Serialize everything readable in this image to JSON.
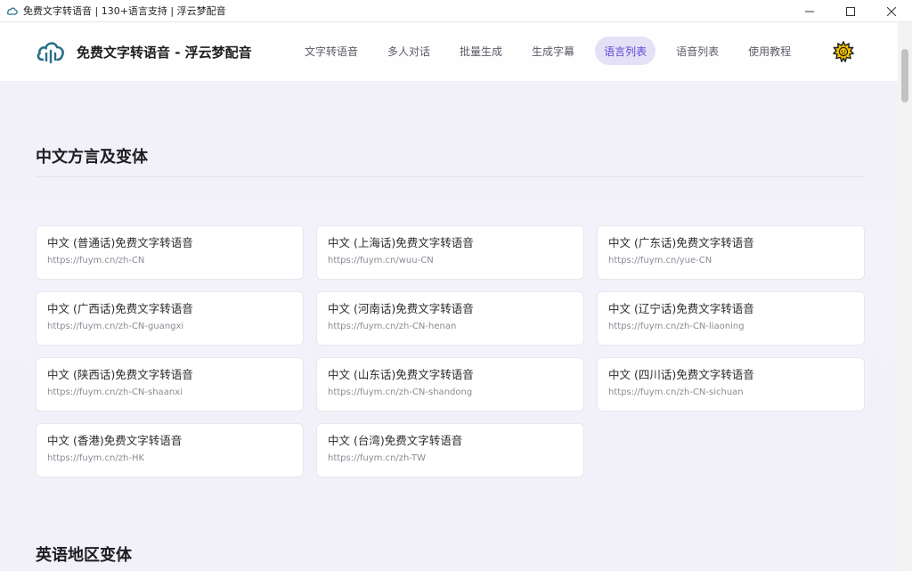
{
  "window": {
    "title": "免费文字转语音 | 130+语言支持 | 浮云梦配音",
    "controls": {
      "minimize": "—",
      "maximize": "☐",
      "close": "✕"
    }
  },
  "header": {
    "brand": "免费文字转语音 - 浮云梦配音",
    "nav": [
      {
        "label": "文字转语音",
        "active": false
      },
      {
        "label": "多人对话",
        "active": false
      },
      {
        "label": "批量生成",
        "active": false
      },
      {
        "label": "生成字幕",
        "active": false
      },
      {
        "label": "语言列表",
        "active": true
      },
      {
        "label": "语音列表",
        "active": false
      },
      {
        "label": "使用教程",
        "active": false
      }
    ],
    "theme_icon": "sun-icon"
  },
  "sections": [
    {
      "title": "中文方言及变体",
      "cards": [
        {
          "title": "中文 (普通话)免费文字转语音",
          "url": "https://fuym.cn/zh-CN"
        },
        {
          "title": "中文 (上海话)免费文字转语音",
          "url": "https://fuym.cn/wuu-CN"
        },
        {
          "title": "中文 (广东话)免费文字转语音",
          "url": "https://fuym.cn/yue-CN"
        },
        {
          "title": "中文 (广西话)免费文字转语音",
          "url": "https://fuym.cn/zh-CN-guangxi"
        },
        {
          "title": "中文 (河南话)免费文字转语音",
          "url": "https://fuym.cn/zh-CN-henan"
        },
        {
          "title": "中文 (辽宁话)免费文字转语音",
          "url": "https://fuym.cn/zh-CN-liaoning"
        },
        {
          "title": "中文 (陕西话)免费文字转语音",
          "url": "https://fuym.cn/zh-CN-shaanxi"
        },
        {
          "title": "中文 (山东话)免费文字转语音",
          "url": "https://fuym.cn/zh-CN-shandong"
        },
        {
          "title": "中文 (四川话)免费文字转语音",
          "url": "https://fuym.cn/zh-CN-sichuan"
        },
        {
          "title": "中文 (香港)免费文字转语音",
          "url": "https://fuym.cn/zh-HK"
        },
        {
          "title": "中文 (台湾)免费文字转语音",
          "url": "https://fuym.cn/zh-TW"
        }
      ]
    },
    {
      "title": "英语地区变体",
      "cards": []
    }
  ]
}
